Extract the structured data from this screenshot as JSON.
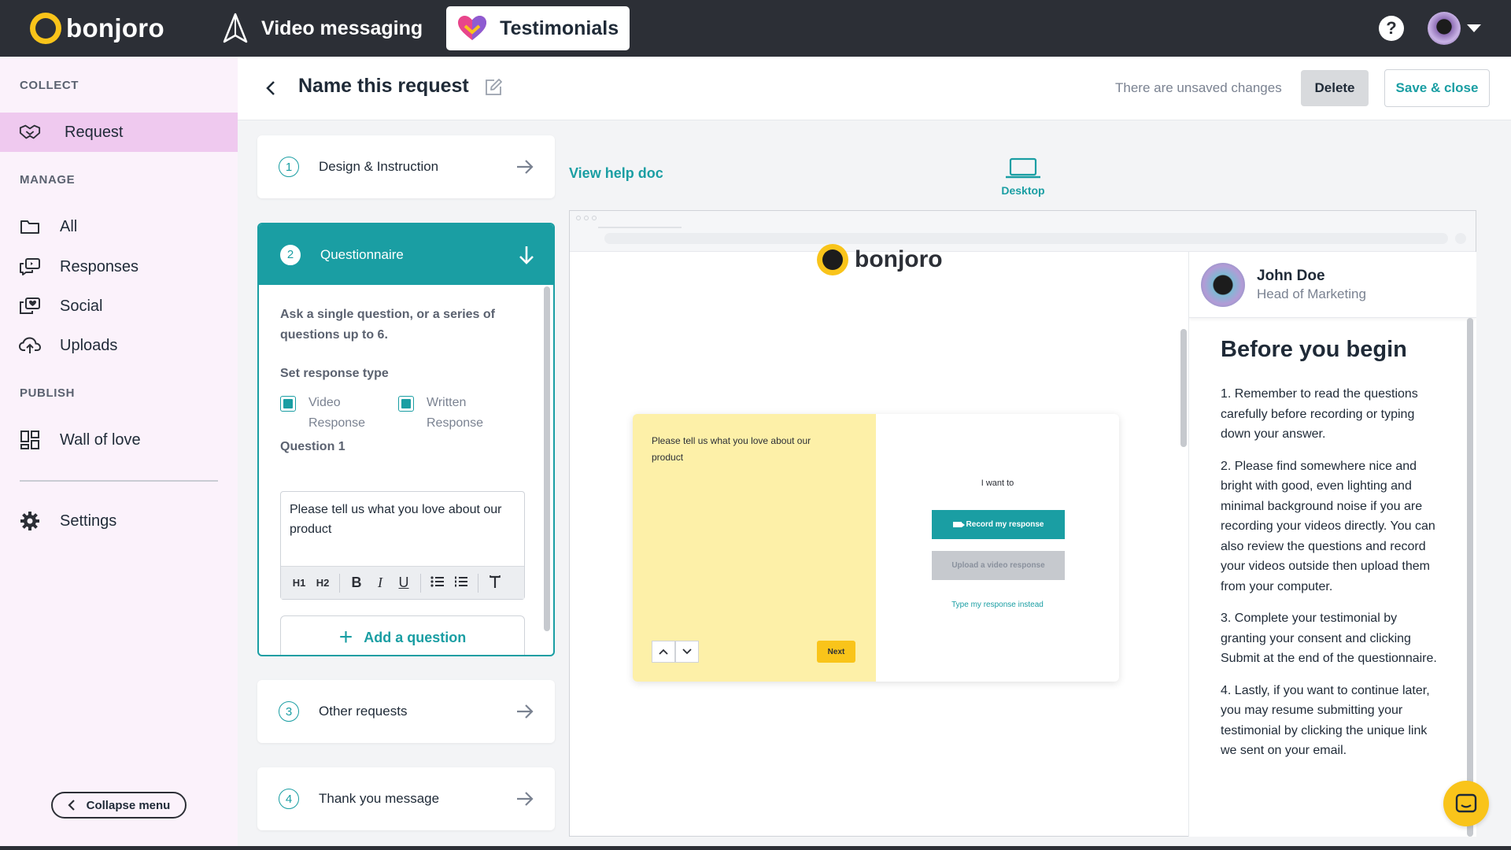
{
  "topbar": {
    "brand": "bonjoro",
    "nav": [
      {
        "label": "Video messaging",
        "icon": "paper-plane-icon"
      },
      {
        "label": "Testimonials",
        "icon": "heart-icon"
      }
    ],
    "help": "?"
  },
  "sidebar": {
    "sections": {
      "collect": "COLLECT",
      "manage": "MANAGE",
      "publish": "PUBLISH"
    },
    "items": {
      "request": "Request",
      "all": "All",
      "responses": "Responses",
      "social": "Social",
      "uploads": "Uploads",
      "wall": "Wall of love",
      "settings": "Settings"
    },
    "collapse": "Collapse menu"
  },
  "header": {
    "title": "Name this request",
    "status": "There are unsaved changes",
    "delete": "Delete",
    "save": "Save & close"
  },
  "steps": [
    {
      "num": "1",
      "label": "Design & Instruction"
    },
    {
      "num": "2",
      "label": "Questionnaire"
    },
    {
      "num": "3",
      "label": "Other requests"
    },
    {
      "num": "4",
      "label": "Thank you message"
    }
  ],
  "questionnaire": {
    "intro": "Ask a single question, or a series of questions up to 6.",
    "response_type_label": "Set response type",
    "video_response": "Video Response",
    "written_response": "Written Response",
    "question_label": "Question 1",
    "question_text": "Please tell us what you love about our product",
    "toolbar": {
      "h1": "H1",
      "h2": "H2",
      "b": "B",
      "i": "I",
      "u": "U"
    },
    "add_question": "Add a question"
  },
  "preview": {
    "help_link": "View help doc",
    "device": "Desktop",
    "brand": "bonjoro",
    "question": "Please tell us what you love about our product",
    "i_want_to": "I want to",
    "record": "Record my response",
    "upload": "Upload a video response",
    "type_instead": "Type my response instead",
    "next": "Next",
    "user_name": "John Doe",
    "user_role": "Head of Marketing",
    "before_title": "Before you begin",
    "instructions": [
      "1.  Remember to read the questions carefully before recording or typing down your answer.",
      "2.  Please find somewhere nice and bright with good, even lighting and minimal background noise if you are recording your videos directly. You can also review the questions and record your videos outside then upload them from your computer.",
      "3.  Complete your testimonial by granting your consent and clicking Submit at the end of the questionnaire.",
      "4.  Lastly, if you want to continue later, you may resume submitting your testimonial by clicking the unique link we sent on your email."
    ]
  },
  "colors": {
    "accent": "#1a9ea3",
    "brand_yellow": "#f9c41a",
    "topbar": "#2c2f36",
    "sidebar_active": "#efc9ef"
  }
}
